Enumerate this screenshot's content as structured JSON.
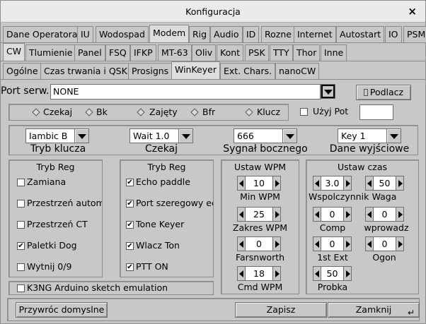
{
  "window": {
    "title": "Konfiguracja",
    "close": "×"
  },
  "tabs_main": [
    "Dane Operatora",
    "IU",
    "Wodospad",
    "Modem",
    "Rig",
    "Audio",
    "ID",
    "Rozne",
    "Internet",
    "Autostart",
    "IO",
    "PSM"
  ],
  "tabs_modem": [
    "CW",
    "Tlumienie",
    "Panel",
    "FSQ",
    "IFKP",
    "MT-63",
    "Oliv",
    "Kont",
    "PSK",
    "TTY",
    "Thor",
    "Inne"
  ],
  "tabs_cw": [
    "Ogólne",
    "Czas trwania i QSK",
    "Prosigns",
    "WinKeyer",
    "Ext. Chars.",
    "nanoCW"
  ],
  "serial": {
    "label": "Port serw.",
    "value": "NONE",
    "connect": "Podlacz"
  },
  "status": {
    "items": [
      "Czekaj",
      "Bk",
      "Zajęty",
      "Bfr",
      "Klucz"
    ],
    "use_pot": "Użyj Pot",
    "pot_value": ""
  },
  "dropdowns": [
    {
      "value": "Iambic B",
      "label": "Tryb klucza"
    },
    {
      "value": "Wait 1.0",
      "label": "Czekaj"
    },
    {
      "value": "666",
      "label": "Sygnał bocznego"
    },
    {
      "value": "Key 1",
      "label": "Dane wyjściowe"
    }
  ],
  "mode_reg1": {
    "title": "Tryb Reg",
    "items": [
      {
        "label": "Zamiana",
        "checked": false
      },
      {
        "label": "Przestrzeń automatycz",
        "checked": false
      },
      {
        "label": "Przestrzeń CT",
        "checked": false
      },
      {
        "label": "Paletki Dog",
        "checked": true
      },
      {
        "label": "Wytnij 0/9",
        "checked": false
      }
    ]
  },
  "mode_reg2": {
    "title": "Tryb Reg",
    "items": [
      {
        "label": "Echo paddle",
        "checked": true
      },
      {
        "label": "Port szeregowy echo",
        "checked": true
      },
      {
        "label": "Tone Keyer",
        "checked": true
      },
      {
        "label": "Wlacz Ton",
        "checked": true
      },
      {
        "label": "PTT ON",
        "checked": true
      }
    ]
  },
  "k3ng": {
    "label": "K3NG Arduino sketch emulation",
    "checked": false
  },
  "wpm": {
    "title": "Ustaw WPM",
    "items": [
      {
        "value": "10",
        "label": "Min WPM"
      },
      {
        "value": "25",
        "label": "Zakres WPM"
      },
      {
        "value": "0",
        "label": "Farsnworth"
      },
      {
        "value": "18",
        "label": "Cmd WPM"
      }
    ]
  },
  "times": {
    "title": "Ustaw czas",
    "ratio": {
      "value": "3.0",
      "label": "Wspolczynnik"
    },
    "weight": {
      "value": "50",
      "label": "Waga"
    },
    "comp": {
      "value": "0",
      "label": "Comp"
    },
    "lead": {
      "value": "0",
      "label": "wprowadz"
    },
    "ext": {
      "value": "0",
      "label": "1st Ext"
    },
    "tail": {
      "value": "0",
      "label": "Ogon"
    },
    "sample": {
      "value": "50",
      "label": "Probka"
    }
  },
  "buttons": {
    "restore": "Przywróc domyslne",
    "save": "Zapisz",
    "close": "Zamknij"
  }
}
